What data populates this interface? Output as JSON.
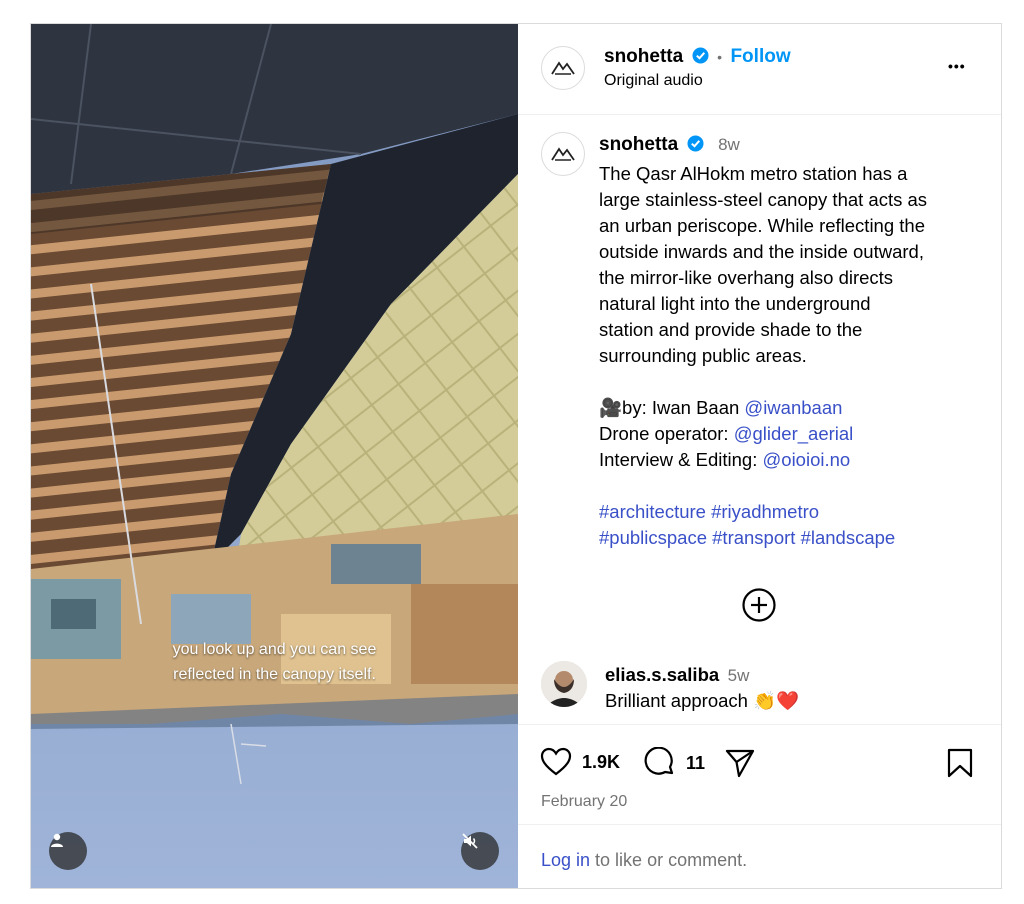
{
  "media": {
    "overlay_line1": "you look up and you can see",
    "overlay_line2": "reflected in the canopy itself."
  },
  "header": {
    "username": "snohetta",
    "separator": "•",
    "follow_label": "Follow",
    "audio": "Original audio",
    "more": "•••"
  },
  "caption": {
    "username": "snohetta",
    "time": "8w",
    "body_lines": [
      "The Qasr AlHokm metro station has a",
      "large stainless-steel canopy that acts as",
      "an urban periscope. While reflecting the",
      "outside inwards and the inside outward,",
      "the mirror-like overhang also directs",
      "natural light into the underground",
      "station and provide shade to the",
      "surrounding public areas."
    ],
    "credit1_prefix": "🎥by: Iwan Baan ",
    "credit1_handle": "@iwanbaan",
    "credit2_prefix": "Drone operator: ",
    "credit2_handle": "@glider_aerial",
    "credit3_prefix": "Interview & Editing: ",
    "credit3_handle": "@oioioi.no",
    "tags_line1": [
      "#architecture",
      "#riyadhmetro"
    ],
    "tags_line2": [
      "#publicspace",
      "#transport",
      "#landscape"
    ]
  },
  "comment": {
    "username": "elias.s.saliba",
    "time": "5w",
    "text": "Brilliant approach 👏❤️"
  },
  "stats": {
    "likes": "1.9K",
    "comments": "11",
    "date": "February 20"
  },
  "login": {
    "link": "Log in",
    "rest": " to like or comment."
  },
  "colors": {
    "link": "#3a50c8",
    "follow": "#0095f6",
    "verified": "#0095f6"
  }
}
